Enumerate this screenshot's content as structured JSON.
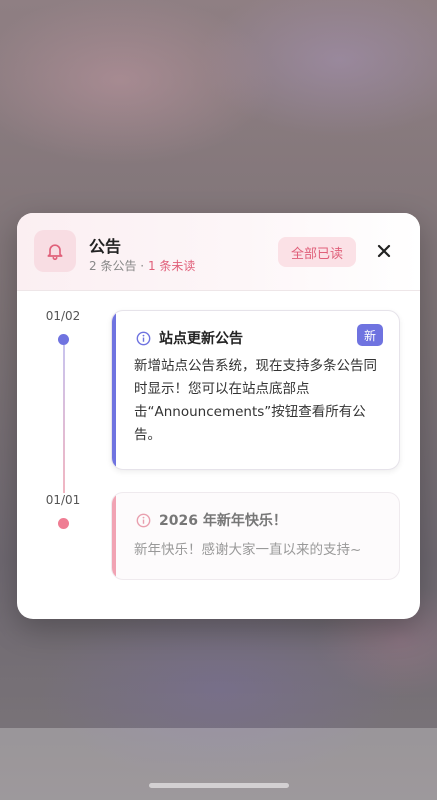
{
  "modal": {
    "title": "公告",
    "count_text": "2 条公告",
    "separator": "·",
    "unread_text": "1 条未读",
    "mark_all_read_label": "全部已读",
    "close_icon": "close-icon",
    "bell_icon": "bell-icon"
  },
  "announcements": [
    {
      "date": "01/02",
      "title": "站点更新公告",
      "badge": "新",
      "body": "新增站点公告系统，现在支持多条公告同时显示！您可以在站点底部点击“Announcements”按钮查看所有公告。",
      "icon": "info-icon",
      "unread": true,
      "accent_color": "#6f73e0"
    },
    {
      "date": "01/01",
      "title": "2026 年新年快乐！",
      "body": "新年快乐！感谢大家一直以来的支持~",
      "icon": "info-icon",
      "unread": false,
      "accent_color": "#f1a3b3"
    }
  ],
  "colors": {
    "accent_pink": "#e0607a",
    "accent_indigo": "#6f73e0"
  }
}
